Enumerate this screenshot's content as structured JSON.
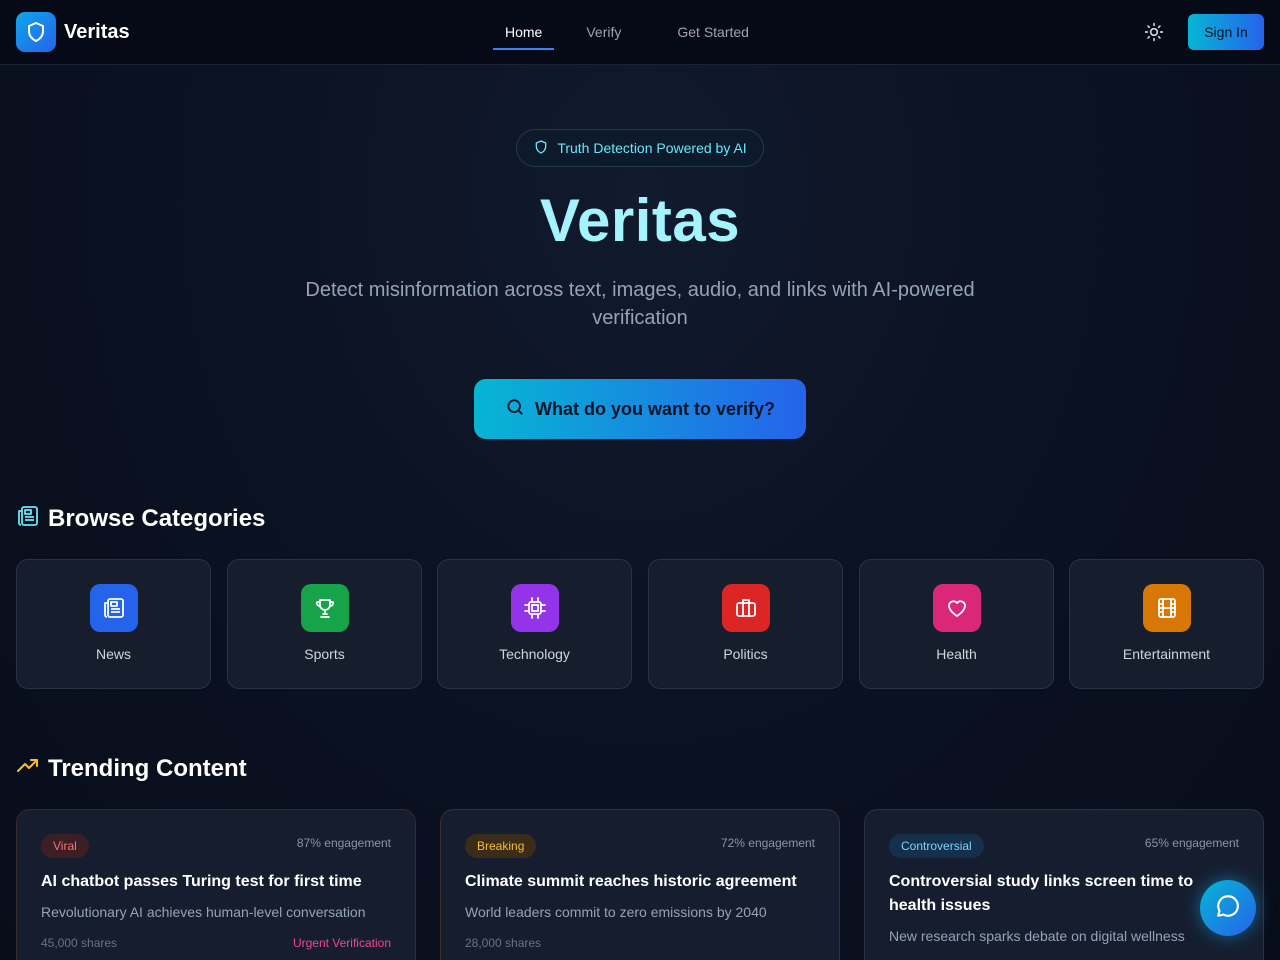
{
  "header": {
    "logo_text": "Veritas",
    "nav": [
      {
        "label": "Home",
        "active": true
      },
      {
        "label": "Verify",
        "active": false
      },
      {
        "label": "Get Started",
        "active": false
      }
    ],
    "theme_icon": "sun-icon",
    "signin_label": "Sign In"
  },
  "hero": {
    "pill_text": "Truth Detection Powered by AI",
    "title": "Veritas",
    "subtitle": "Detect misinformation across text, images, audio, and links with AI-powered verification",
    "cta_label": "What do you want to verify?"
  },
  "categories": {
    "heading": "Browse Categories",
    "items": [
      {
        "label": "News",
        "icon": "newspaper-icon",
        "color": "#2563eb"
      },
      {
        "label": "Sports",
        "icon": "trophy-icon",
        "color": "#16a34a"
      },
      {
        "label": "Technology",
        "icon": "cpu-icon",
        "color": "#9333ea"
      },
      {
        "label": "Politics",
        "icon": "briefcase-icon",
        "color": "#dc2626"
      },
      {
        "label": "Health",
        "icon": "heart-icon",
        "color": "#db2777"
      },
      {
        "label": "Entertainment",
        "icon": "film-icon",
        "color": "#d97706"
      }
    ]
  },
  "trending": {
    "heading": "Trending Content",
    "cards": [
      {
        "badge": "Viral",
        "badge_color": "#f87171",
        "badge_bg": "#3b1f24",
        "engagement": "87% engagement",
        "title": "AI chatbot passes Turing test for first time",
        "description": "Revolutionary AI achieves human-level conversation",
        "shares": "45,000 shares",
        "flag": "Urgent Verification"
      },
      {
        "badge": "Breaking",
        "badge_color": "#fbbf24",
        "badge_bg": "#3b2c1a",
        "engagement": "72% engagement",
        "title": "Climate summit reaches historic agreement",
        "description": "World leaders commit to zero emissions by 2040",
        "shares": "28,000 shares",
        "flag": ""
      },
      {
        "badge": "Controversial",
        "badge_color": "#7dd3fc",
        "badge_bg": "#14304a",
        "engagement": "65% engagement",
        "title": "Controversial study links screen time to health issues",
        "description": "New research sparks debate on digital wellness",
        "shares": "",
        "flag": ""
      }
    ]
  },
  "chat_icon": "chat-bubble-icon",
  "colors": {
    "accent": "#06b6d4",
    "accent2": "#2563eb",
    "title": "#a5f3fc"
  }
}
